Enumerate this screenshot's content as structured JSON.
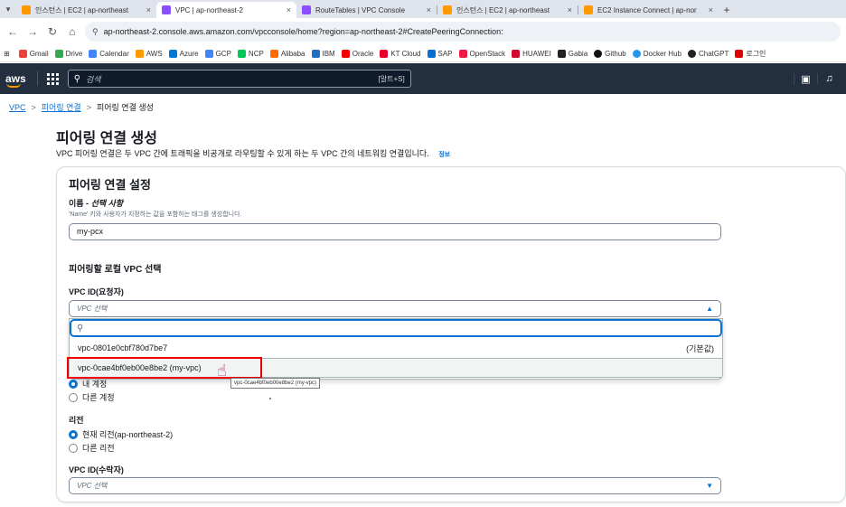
{
  "browser": {
    "tabs": [
      {
        "label": "인스턴스 | EC2 | ap-northeast",
        "color": "#ff9900",
        "active": false
      },
      {
        "label": "VPC | ap-northeast-2",
        "color": "#8c4fff",
        "active": true
      },
      {
        "label": "RouteTables | VPC Console",
        "color": "#8c4fff",
        "active": false
      },
      {
        "label": "인스턴스 | EC2 | ap-northeast",
        "color": "#ff9900",
        "active": false
      },
      {
        "label": "EC2 Instance Connect | ap-nor",
        "color": "#ff9900",
        "active": false
      }
    ],
    "tab_close": "×",
    "new_tab": "+",
    "url": "ap-northeast-2.console.aws.amazon.com/vpcconsole/home?region=ap-northeast-2#CreatePeeringConnection:",
    "bookmarks": [
      {
        "label": "Gmail",
        "color": "#ea4335"
      },
      {
        "label": "Drive",
        "color": "#34a853"
      },
      {
        "label": "Calendar",
        "color": "#4285f4"
      },
      {
        "label": "AWS",
        "color": "#ff9900"
      },
      {
        "label": "Azure",
        "color": "#0078d4"
      },
      {
        "label": "GCP",
        "color": "#4285f4"
      },
      {
        "label": "NCP",
        "color": "#03c75a"
      },
      {
        "label": "Alibaba",
        "color": "#ff6a00"
      },
      {
        "label": "IBM",
        "color": "#1f70c1"
      },
      {
        "label": "Oracle",
        "color": "#f80000"
      },
      {
        "label": "KT Cloud",
        "color": "#e5002b"
      },
      {
        "label": "SAP",
        "color": "#0a6ed1"
      },
      {
        "label": "OpenStack",
        "color": "#ed1944"
      },
      {
        "label": "HUAWEI",
        "color": "#cf0a2c"
      },
      {
        "label": "Gabia",
        "color": "#222222"
      },
      {
        "label": "Github",
        "color": "#111111"
      },
      {
        "label": "Docker Hub",
        "color": "#2496ed"
      },
      {
        "label": "ChatGPT",
        "color": "#222222"
      },
      {
        "label": "로그인",
        "color": "#e00000"
      }
    ]
  },
  "aws": {
    "logo": "aws",
    "search_placeholder": "검색",
    "search_shortcut": "[알트+S]"
  },
  "breadcrumb": {
    "items": [
      "VPC",
      "피어링 연결"
    ],
    "current": "피어링 연결 생성",
    "separator": ">"
  },
  "page": {
    "title": "피어링 연결 생성",
    "description": "VPC 피어링 연결은 두 VPC 간에 트래픽을 비공개로 라우팅할 수 있게 하는 두 VPC 간의 네트워킹 연결입니다.",
    "info_link": "정보"
  },
  "settings": {
    "title": "피어링 연결 설정",
    "name_label": "이름 - ",
    "name_optional": "선택 사항",
    "name_hint": "'Name' 키와 사용자가 지정하는 값을 포함하는 태그를 생성합니다.",
    "name_value": "my-pcx",
    "local_vpc_section": "피어링할 로컬 VPC 선택",
    "requester_label": "VPC ID(요청자)",
    "requester_placeholder": "VPC 선택",
    "dropdown_options": [
      {
        "label": "vpc-0801e0cbf780d7be7",
        "tag": "(기본값)"
      },
      {
        "label": "vpc-0cae4bf0eb00e8be2 (my-vpc)",
        "tag": ""
      }
    ],
    "tooltip": "vpc-0cae4bf0eb00e8be2 (my-vpc)",
    "account_options": [
      "내 계정",
      "다른 계정"
    ],
    "region_label": "리전",
    "region_options": [
      "현재 리전(ap-northeast-2)",
      "다른 리전"
    ],
    "accepter_label": "VPC ID(수락자)",
    "accepter_placeholder": "VPC 선택"
  }
}
